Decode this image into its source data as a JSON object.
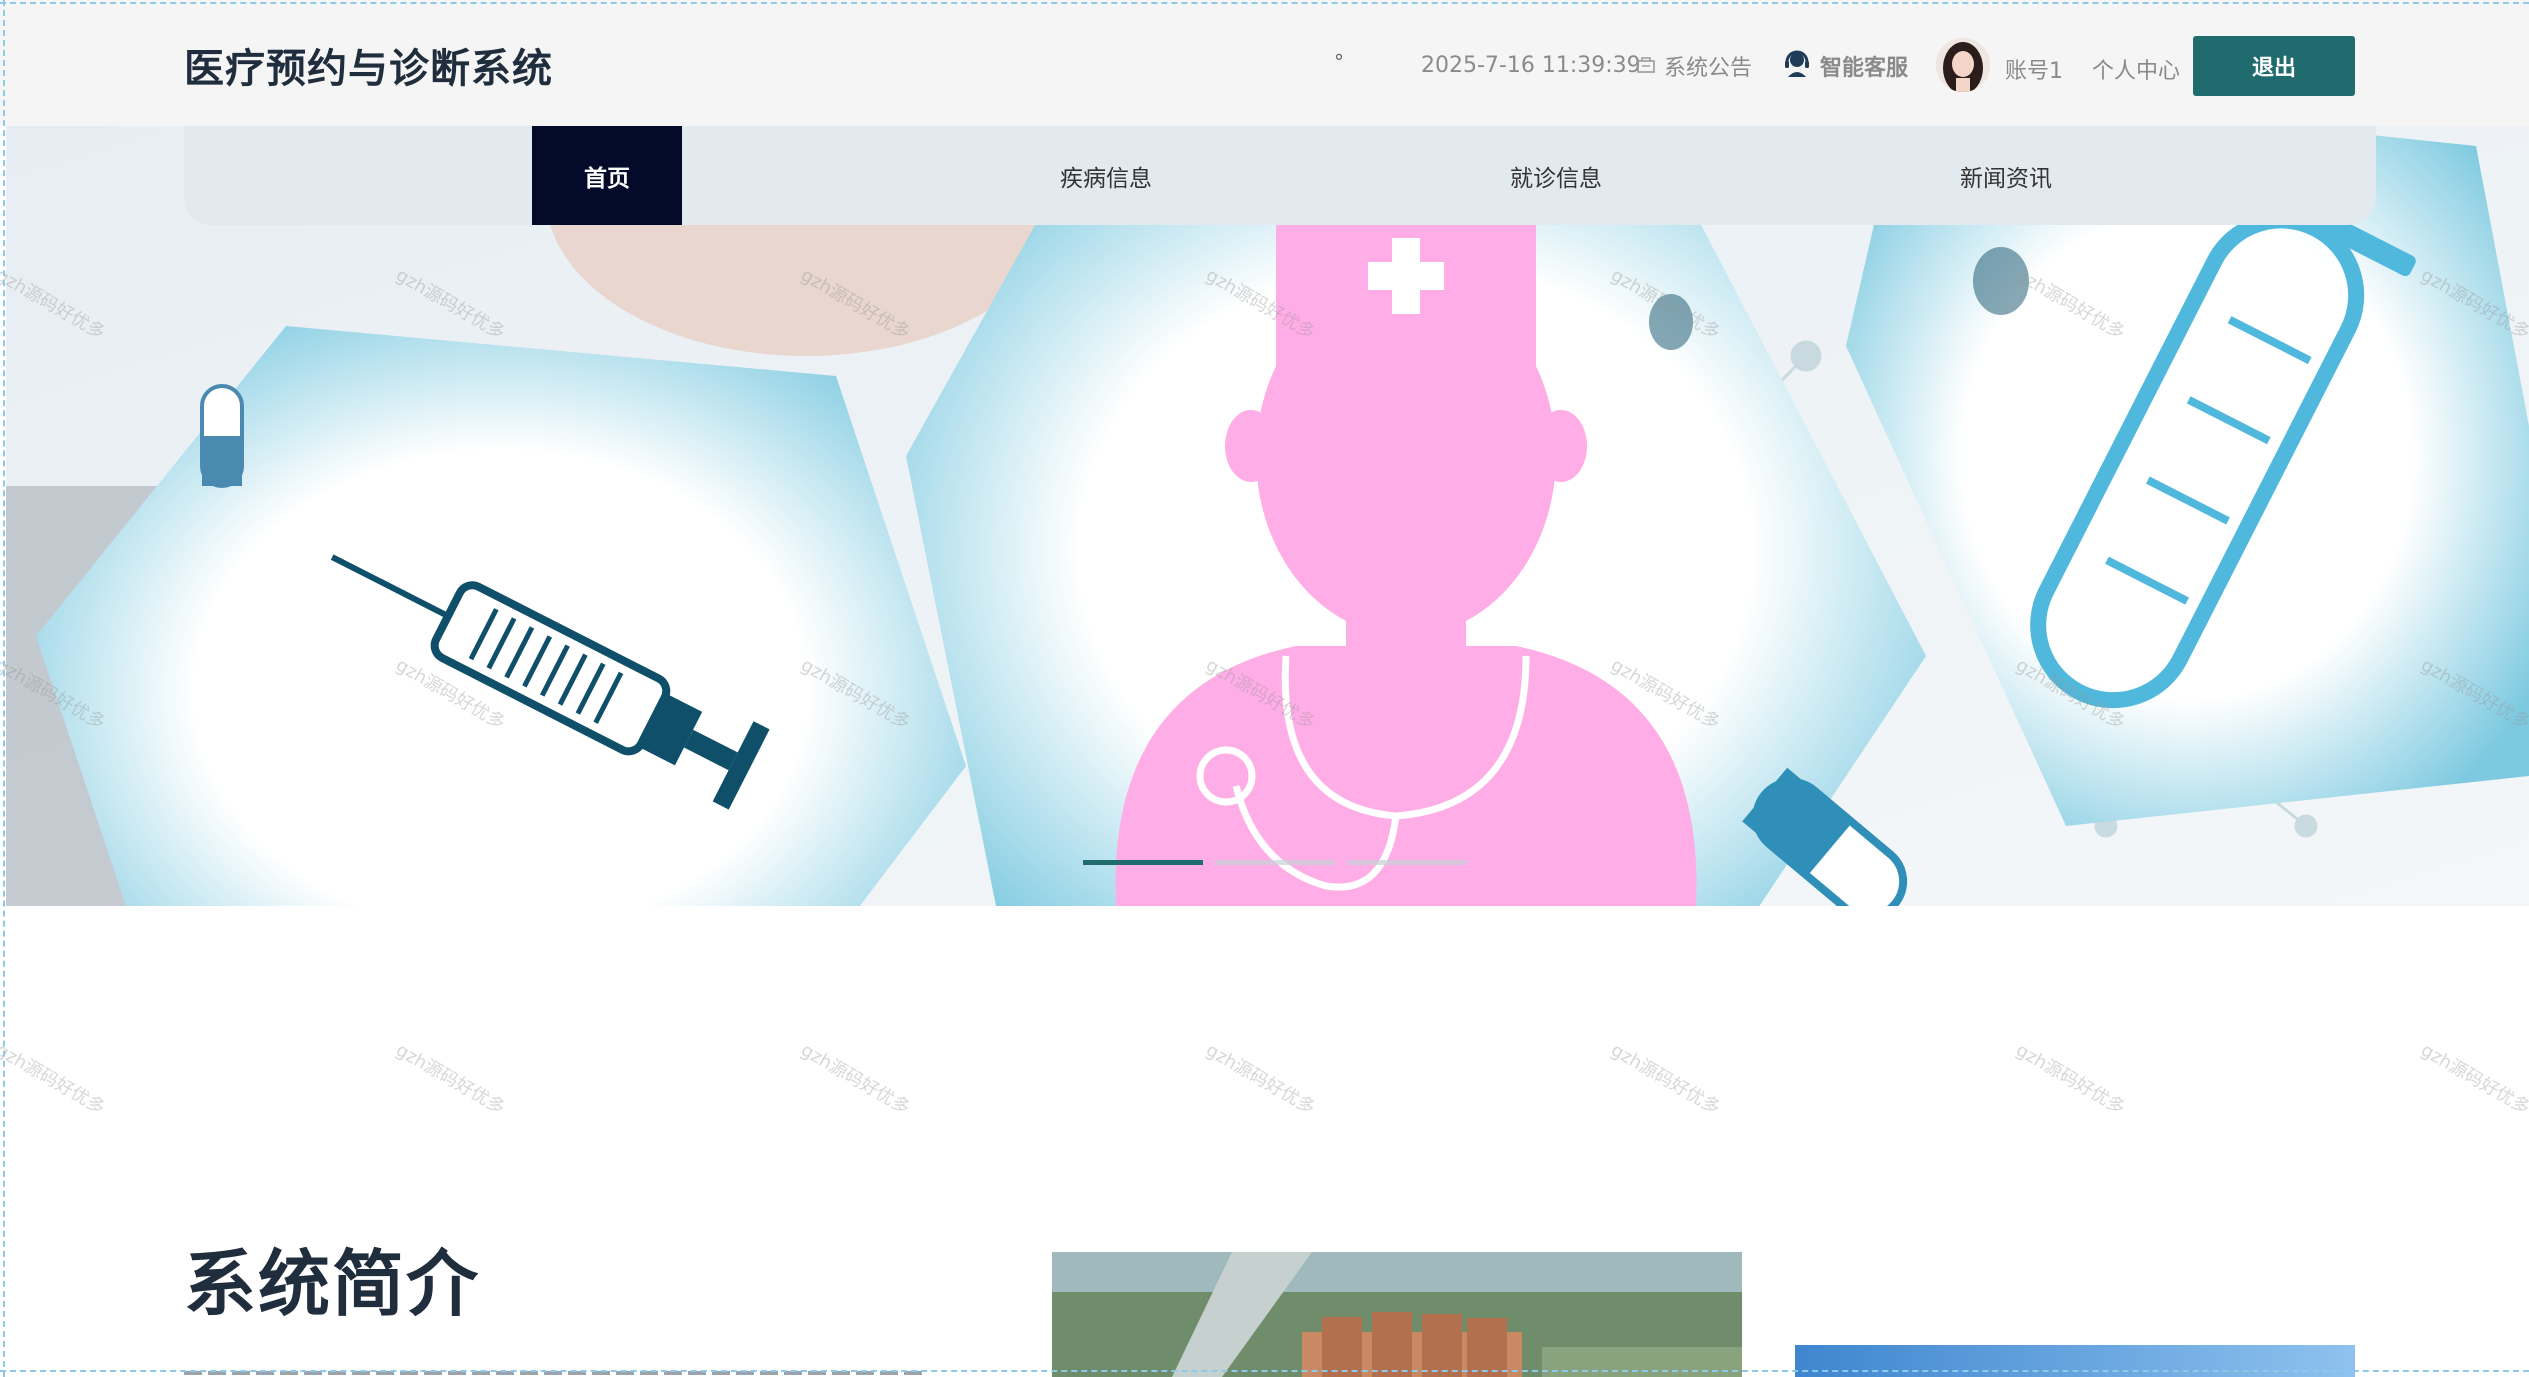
{
  "header": {
    "title": "医疗预约与诊断系统",
    "dot": "°",
    "datetime": "2025-7-16 11:39:39",
    "notice_label": "系统公告",
    "service_label": "智能客服",
    "account_label": "账号1",
    "profile_label": "个人中心",
    "logout_label": "退出"
  },
  "nav": {
    "items": [
      {
        "label": "首页",
        "active": true
      },
      {
        "label": "疾病信息",
        "active": false
      },
      {
        "label": "就诊信息",
        "active": false
      },
      {
        "label": "新闻资讯",
        "active": false
      }
    ]
  },
  "banner": {
    "slide_count": 3,
    "active_slide": 1
  },
  "intro": {
    "title": "系统简介"
  },
  "watermark_text": "gzh源码好优多",
  "colors": {
    "accent": "#1f6b6e",
    "nav_active": "#040b2a",
    "nav_bg": "#e2e9ef",
    "header_bg": "#f5f5f5"
  }
}
